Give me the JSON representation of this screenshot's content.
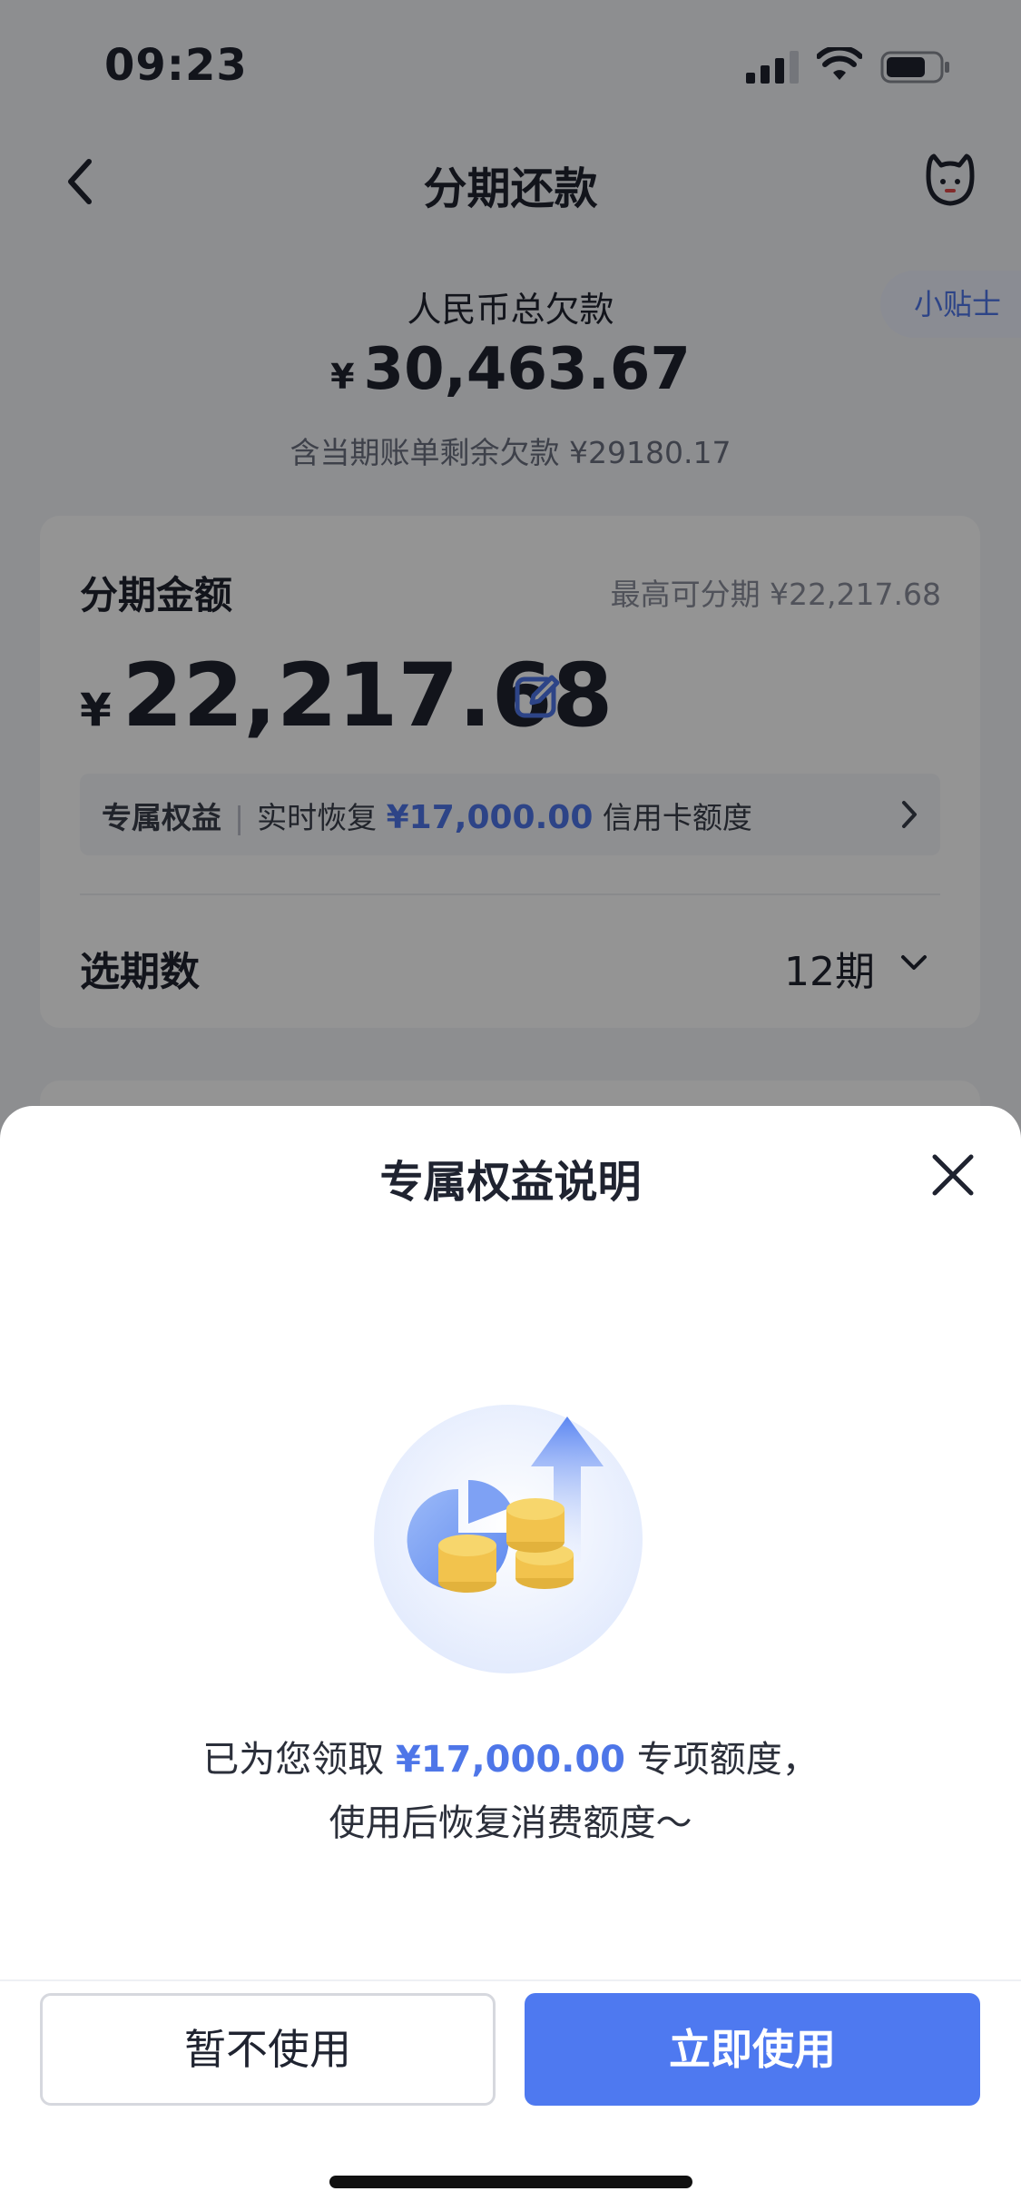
{
  "status_bar": {
    "time": "09:23"
  },
  "nav": {
    "title": "分期还款"
  },
  "tips_label": "小贴士",
  "debt": {
    "label": "人民币总欠款",
    "currency": "¥",
    "amount": "30,463.67",
    "note": "含当期账单剩余欠款 ¥29180.17"
  },
  "installment": {
    "label": "分期金额",
    "max_text": "最高可分期 ¥22,217.68",
    "currency": "¥",
    "amount": "22,217.68",
    "benefit_label": "专属权益",
    "benefit_prefix": "实时恢复",
    "benefit_amount": "¥17,000.00",
    "benefit_suffix": "信用卡额度",
    "period_label": "选期数",
    "period_value": "12期"
  },
  "sheet": {
    "title": "专属权益说明",
    "desc_prefix": "已为您领取",
    "desc_amount": "¥17,000.00",
    "desc_suffix": "专项额度，",
    "desc_line2": "使用后恢复消费额度～",
    "cancel_label": "暂不使用",
    "confirm_label": "立即使用"
  },
  "colors": {
    "accent": "#4e79f0",
    "text": "#1f2330",
    "sheet_bg": "#ffffff"
  },
  "icons": [
    "back-icon",
    "customer-service-icon",
    "edit-icon",
    "chevron-right-icon",
    "chevron-down-icon",
    "close-icon"
  ]
}
